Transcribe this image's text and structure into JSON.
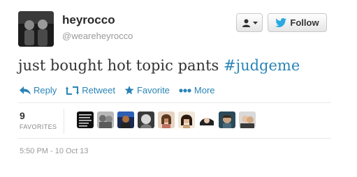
{
  "tweet": {
    "display_name": "heyrocco",
    "screen_name": "@weareheyrocco",
    "text_plain": "just bought hot topic pants ",
    "hashtag": "#judgeme",
    "timestamp": "5:50 PM - 10 Oct 13"
  },
  "header": {
    "follow_label": "Follow",
    "user_menu_icon": "user-icon",
    "dropdown_icon": "caret-down-icon"
  },
  "actions": [
    {
      "label": "Reply",
      "icon": "reply-icon"
    },
    {
      "label": "Retweet",
      "icon": "retweet-icon"
    },
    {
      "label": "Favorite",
      "icon": "star-icon"
    },
    {
      "label": "More",
      "icon": "more-dots-icon"
    }
  ],
  "stats": {
    "favorites_count": "9",
    "favorites_label": "FAVORITES"
  },
  "favoriters_avatar_count": 9,
  "colors": {
    "link": "#2a84b6",
    "twitter_blue": "#2aa9e0"
  }
}
